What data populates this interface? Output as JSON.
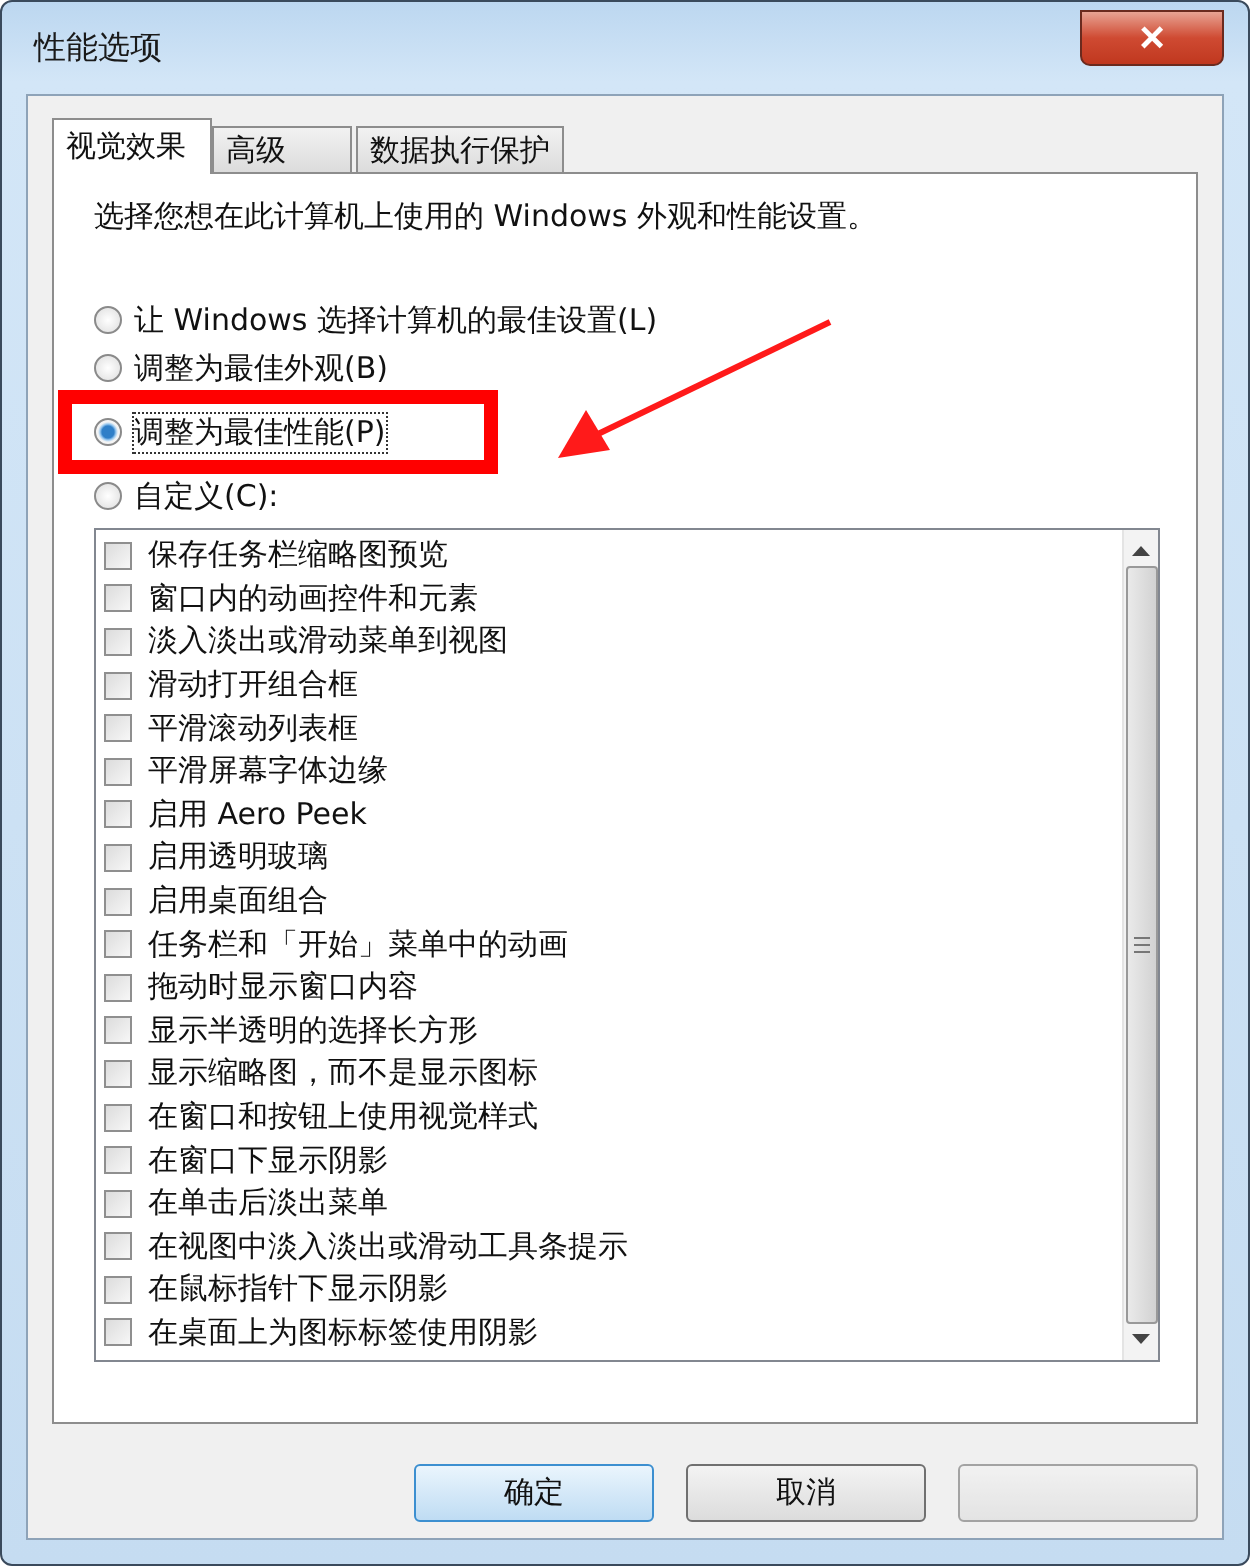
{
  "window": {
    "title": "性能选项",
    "close": "×"
  },
  "tabs": [
    {
      "label": "视觉效果",
      "selected": true
    },
    {
      "label": "高级",
      "selected": false
    },
    {
      "label": "数据执行保护",
      "selected": false
    }
  ],
  "intro": "选择您想在此计算机上使用的 Windows 外观和性能设置。",
  "options": [
    {
      "label": "让 Windows 选择计算机的最佳设置(L)",
      "selected": false
    },
    {
      "label": "调整为最佳外观(B)",
      "selected": false
    },
    {
      "label": "调整为最佳性能(P)",
      "selected": true
    },
    {
      "label": "自定义(C):",
      "selected": false
    }
  ],
  "effects": [
    {
      "label": "保存任务栏缩略图预览",
      "checked": false
    },
    {
      "label": "窗口内的动画控件和元素",
      "checked": false
    },
    {
      "label": "淡入淡出或滑动菜单到视图",
      "checked": false
    },
    {
      "label": "滑动打开组合框",
      "checked": false
    },
    {
      "label": "平滑滚动列表框",
      "checked": false
    },
    {
      "label": "平滑屏幕字体边缘",
      "checked": false
    },
    {
      "label": "启用 Aero Peek",
      "checked": false
    },
    {
      "label": "启用透明玻璃",
      "checked": false
    },
    {
      "label": "启用桌面组合",
      "checked": false
    },
    {
      "label": "任务栏和「开始」菜单中的动画",
      "checked": false
    },
    {
      "label": "拖动时显示窗口内容",
      "checked": false
    },
    {
      "label": "显示半透明的选择长方形",
      "checked": false
    },
    {
      "label": "显示缩略图，而不是显示图标",
      "checked": false
    },
    {
      "label": "在窗口和按钮上使用视觉样式",
      "checked": false
    },
    {
      "label": "在窗口下显示阴影",
      "checked": false
    },
    {
      "label": "在单击后淡出菜单",
      "checked": false
    },
    {
      "label": "在视图中淡入淡出或滑动工具条提示",
      "checked": false
    },
    {
      "label": "在鼠标指针下显示阴影",
      "checked": false
    },
    {
      "label": "在桌面上为图标标签使用阴影",
      "checked": false
    }
  ],
  "buttons": [
    {
      "label": "确定",
      "kind": "default"
    },
    {
      "label": "取消",
      "kind": "normal"
    },
    {
      "kind": "hidden"
    }
  ]
}
